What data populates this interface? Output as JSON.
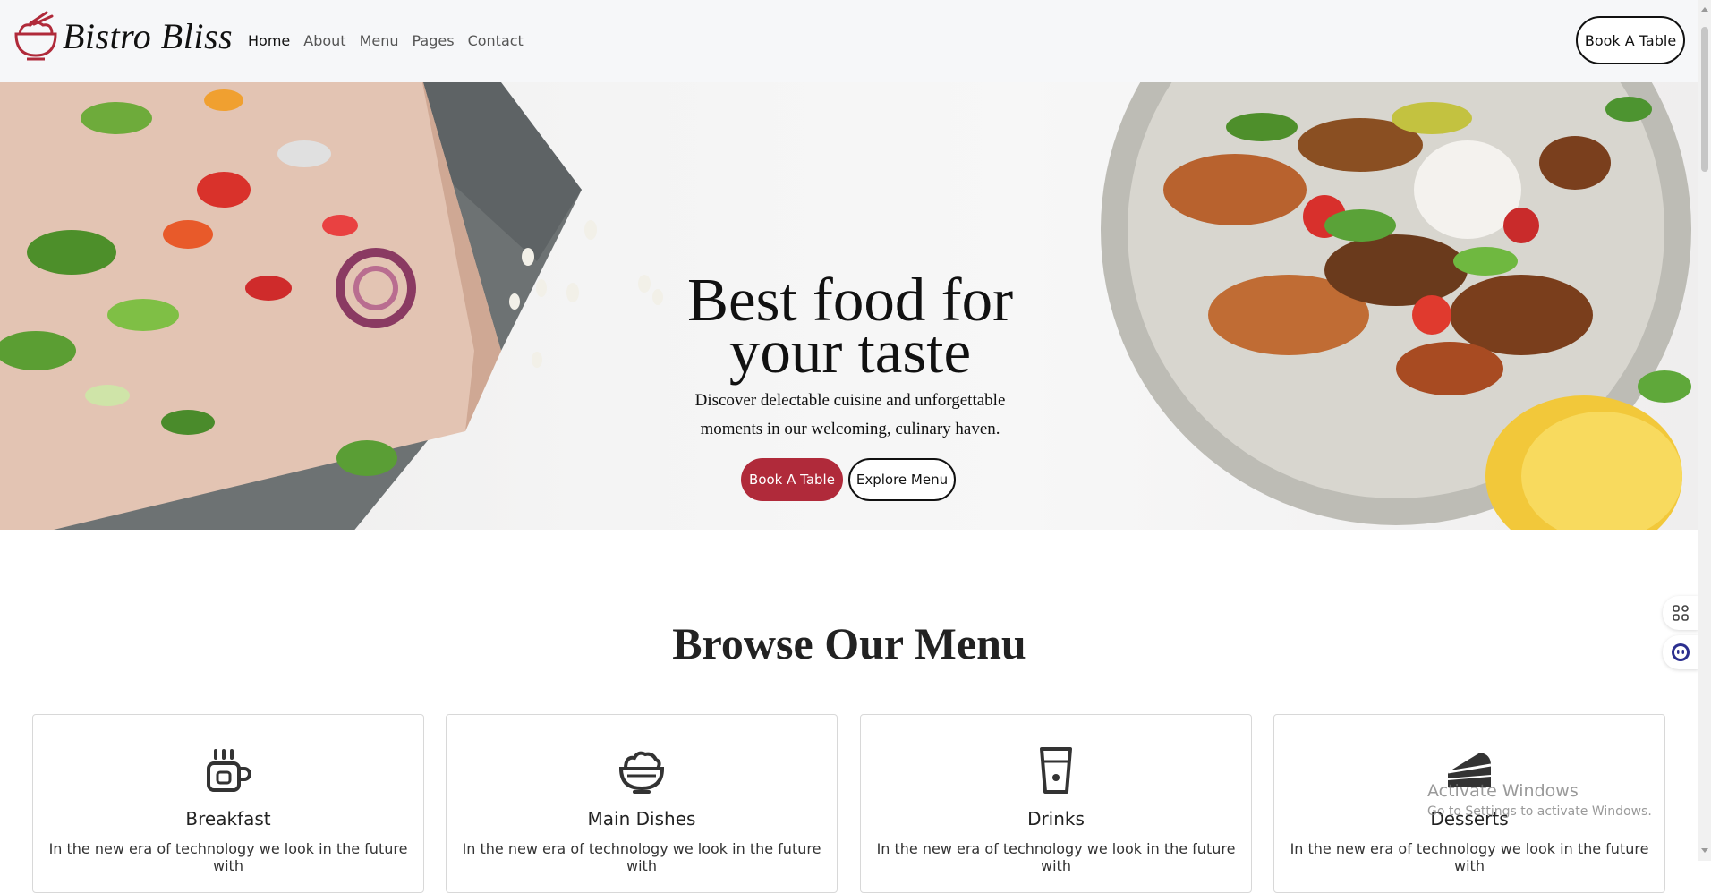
{
  "brand": {
    "name": "Bistro Bliss"
  },
  "nav": {
    "items": [
      {
        "label": "Home",
        "active": true
      },
      {
        "label": "About",
        "active": false
      },
      {
        "label": "Menu",
        "active": false
      },
      {
        "label": "Pages",
        "active": false
      },
      {
        "label": "Contact",
        "active": false
      }
    ],
    "cta_label": "Book A Table"
  },
  "hero": {
    "title_line1": "Best food for",
    "title_line2": "your taste",
    "subtitle_line1": "Discover delectable cuisine and unforgettable",
    "subtitle_line2": "moments in our welcoming, culinary haven.",
    "primary_label": "Book A Table",
    "secondary_label": "Explore Menu"
  },
  "menu_section": {
    "title": "Browse Our Menu",
    "cards": [
      {
        "icon": "coffee-cup-icon",
        "title": "Breakfast",
        "text": "In the new era of technology we look in the future with"
      },
      {
        "icon": "rice-bowl-icon",
        "title": "Main Dishes",
        "text": "In the new era of technology we look in the future with"
      },
      {
        "icon": "drink-glass-icon",
        "title": "Drinks",
        "text": "In the new era of technology we look in the future with"
      },
      {
        "icon": "cake-slice-icon",
        "title": "Desserts",
        "text": "In the new era of technology we look in the future with"
      }
    ]
  },
  "overlay": {
    "activation_title": "Activate Windows",
    "activation_sub": "Go to Settings to activate Windows."
  },
  "colors": {
    "accent": "#b02a3a",
    "dark": "#111111",
    "nav_bg": "#f6f7f9"
  }
}
